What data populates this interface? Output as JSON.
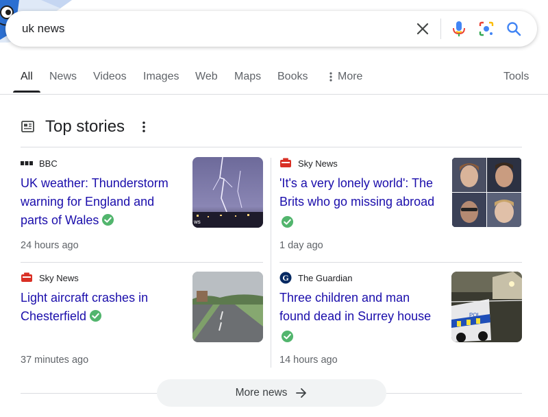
{
  "search": {
    "query": "uk news"
  },
  "tabs": [
    {
      "label": "All"
    },
    {
      "label": "News"
    },
    {
      "label": "Videos"
    },
    {
      "label": "Images"
    },
    {
      "label": "Web"
    },
    {
      "label": "Maps"
    },
    {
      "label": "Books"
    },
    {
      "label": "More"
    },
    {
      "label": "Tools"
    }
  ],
  "top_stories": {
    "title": "Top stories",
    "stories": [
      {
        "source": "BBC",
        "headline": "UK weather: Thunderstorm warning for England and parts of Wales",
        "time": "24 hours ago"
      },
      {
        "source": "Sky News",
        "headline": "'It's a very lonely world': The Brits who go missing abroad",
        "time": "1 day ago"
      },
      {
        "source": "Sky News",
        "headline": "Light aircraft crashes in Chesterfield",
        "time": "37 minutes ago"
      },
      {
        "source": "The Guardian",
        "headline": "Three children and man found dead in Surrey house",
        "time": "14 hours ago"
      }
    ],
    "more_label": "More news"
  },
  "colors": {
    "link": "#1a0dab",
    "verified": "#34a853",
    "accent_blue": "#4285f4"
  },
  "icons": [
    "clear-icon",
    "mic-icon",
    "lens-icon",
    "search-icon",
    "more-vert-icon",
    "newspaper-icon",
    "verified-icon",
    "arrow-right-icon"
  ]
}
